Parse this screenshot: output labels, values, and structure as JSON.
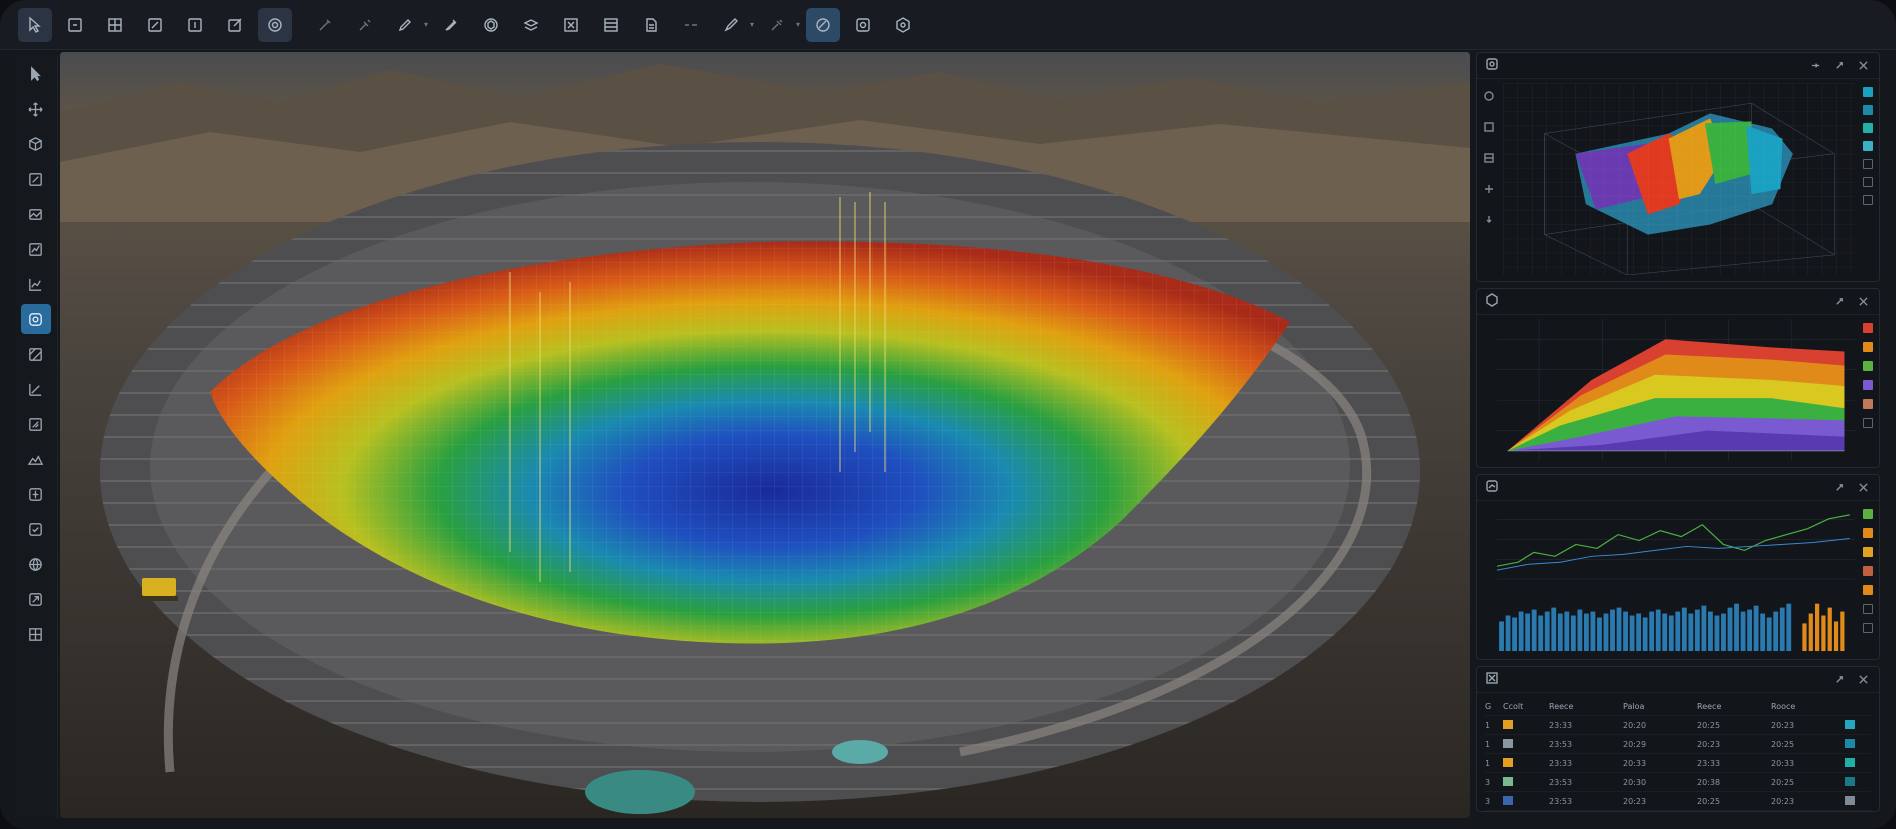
{
  "toolbar": {
    "tools": [
      {
        "icon": "select-cursor-icon",
        "active": true
      },
      {
        "icon": "frame-icon"
      },
      {
        "icon": "grid-icon"
      },
      {
        "icon": "edit-icon"
      },
      {
        "icon": "layer-icon"
      },
      {
        "icon": "edit-square-icon"
      },
      {
        "icon": "target-icon",
        "active": true
      },
      {
        "icon": "brush-icon"
      },
      {
        "icon": "pen-icon"
      },
      {
        "icon": "pencil-icon"
      },
      {
        "icon": "marker-icon"
      },
      {
        "icon": "cube-icon"
      },
      {
        "icon": "layers-icon"
      },
      {
        "icon": "box-icon"
      },
      {
        "icon": "table-icon"
      },
      {
        "icon": "document-icon"
      },
      {
        "icon": "line-icon"
      },
      {
        "icon": "draw-icon"
      },
      {
        "icon": "pipette-icon"
      },
      {
        "icon": "mesh-icon",
        "accent": true
      },
      {
        "icon": "settings-icon"
      },
      {
        "icon": "hex-icon"
      }
    ]
  },
  "lefttools": [
    {
      "icon": "pointer-icon"
    },
    {
      "icon": "move-icon"
    },
    {
      "icon": "cube-icon"
    },
    {
      "icon": "edit-icon"
    },
    {
      "icon": "image-icon"
    },
    {
      "icon": "chart-icon"
    },
    {
      "icon": "line-chart-icon"
    },
    {
      "icon": "target-icon",
      "active": true
    },
    {
      "icon": "section-icon"
    },
    {
      "icon": "slope-icon"
    },
    {
      "icon": "surface-icon"
    },
    {
      "icon": "terrain-icon"
    },
    {
      "icon": "drill-icon"
    },
    {
      "icon": "check-icon"
    },
    {
      "icon": "globe-icon"
    },
    {
      "icon": "export-icon"
    },
    {
      "icon": "grid-icon"
    }
  ],
  "colors": {
    "accent": "#2a6b9e",
    "swatches_p1": [
      "#1aa0c0",
      "#1a8aa6",
      "#22b0a6",
      "#3ab0c4",
      "#7e8a97",
      "#7e8a97",
      "#7e8a97"
    ],
    "swatches_p2": [
      "#d84030",
      "#e08a1a",
      "#5ab040",
      "#7a5ad0",
      "#c07a5a",
      "#7e8a97"
    ],
    "swatches_p3": [
      "#5ab040",
      "#e08a1a",
      "#e0a020",
      "#c06040",
      "#e08a1a",
      "#7e8a97",
      "#7e8a97"
    ],
    "swatches_p4": [
      "#22a8c0",
      "#1a8aa6",
      "#22b0a6",
      "#1a7a88",
      "#7e8a97"
    ]
  },
  "table": {
    "header": [
      "G",
      "Ccolt",
      "Reece",
      "Paloa",
      "Reece",
      "Rooce"
    ],
    "rows": [
      {
        "num": "1",
        "color": "#e0a020",
        "v": [
          "23:33",
          "20:20",
          "20:25",
          "20:23"
        ]
      },
      {
        "num": "1",
        "color": "#8a96a0",
        "v": [
          "23:53",
          "20:29",
          "20:23",
          "20:25"
        ]
      },
      {
        "num": "1",
        "color": "#e0a020",
        "v": [
          "23:33",
          "20:33",
          "23:33",
          "20:33"
        ]
      },
      {
        "num": "3",
        "color": "#7ab890",
        "v": [
          "23:53",
          "20:30",
          "20:38",
          "20:25"
        ]
      },
      {
        "num": "3",
        "color": "#3a66b0",
        "v": [
          "23:53",
          "20:23",
          "20:25",
          "20:23"
        ]
      }
    ]
  }
}
